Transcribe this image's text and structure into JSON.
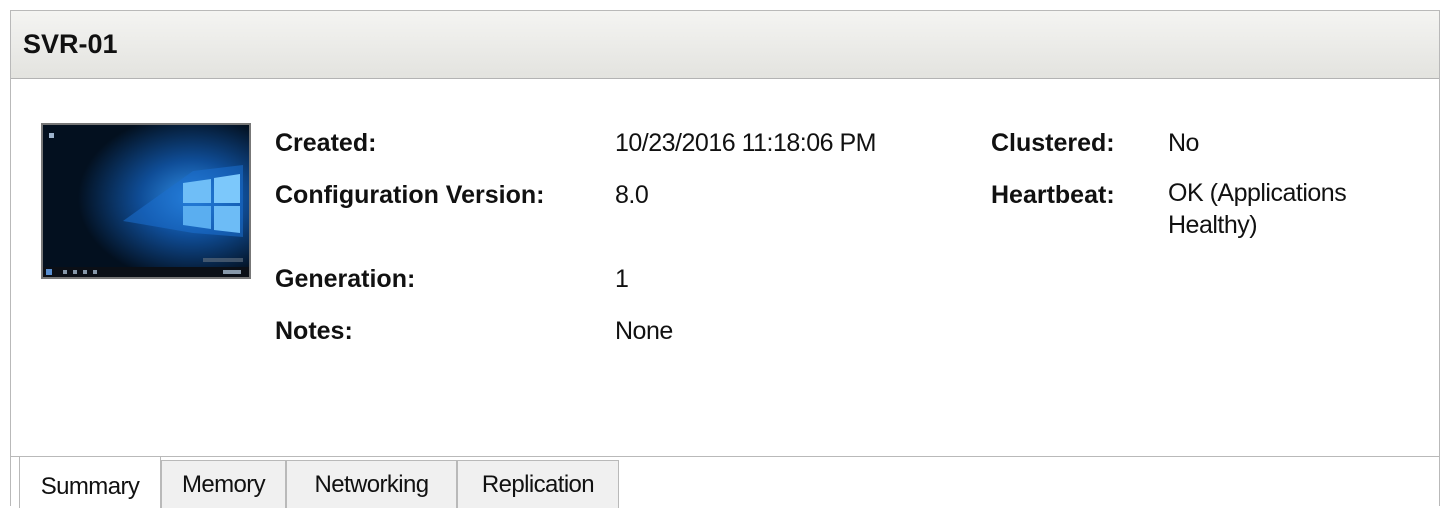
{
  "window": {
    "title": "SVR-01"
  },
  "summary": {
    "created_label": "Created:",
    "created_value": "10/23/2016 11:18:06 PM",
    "config_label": "Configuration Version:",
    "config_value": "8.0",
    "generation_label": "Generation:",
    "generation_value": "1",
    "notes_label": "Notes:",
    "notes_value": "None",
    "clustered_label": "Clustered:",
    "clustered_value": "No",
    "heartbeat_label": "Heartbeat:",
    "heartbeat_value": "OK (Applications Healthy)"
  },
  "tabs": [
    {
      "label": "Summary",
      "active": true
    },
    {
      "label": "Memory",
      "active": false
    },
    {
      "label": "Networking",
      "active": false
    },
    {
      "label": "Replication",
      "active": false
    }
  ],
  "thumbnail": {
    "icon": "windows-desktop-thumbnail"
  }
}
